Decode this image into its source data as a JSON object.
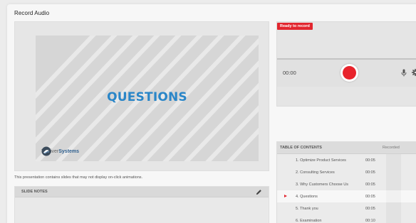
{
  "window": {
    "title": "Record Audio"
  },
  "slide": {
    "heading": "QUESTIONS",
    "logo_prefix": "TriRiver",
    "logo_suffix": "Systems"
  },
  "notice": "This presentation contains slides that may not display on-click animations.",
  "notes": {
    "title": "SLIDE NOTES"
  },
  "recorder": {
    "status": "Ready to record",
    "time": "00:00",
    "status_color": "#e2262f",
    "record_color": "#e8232c"
  },
  "toc": {
    "title": "TABLE OF CONTENTS",
    "recorded_label": "Recorded",
    "items": [
      {
        "label": "1. Optimize Product Services",
        "time": "00:05"
      },
      {
        "label": "2. Consulting Services",
        "time": "00:05"
      },
      {
        "label": "3. Why Customers Choose Us",
        "time": "00:05"
      },
      {
        "label": "4. Questions",
        "time": "00:05",
        "active": true
      },
      {
        "label": "5. Thank you",
        "time": "00:05"
      },
      {
        "label": "6. Examination",
        "time": "00:10"
      }
    ]
  },
  "colors": {
    "accent_blue": "#2a86c8",
    "logo_blue": "#2e5f8f"
  }
}
